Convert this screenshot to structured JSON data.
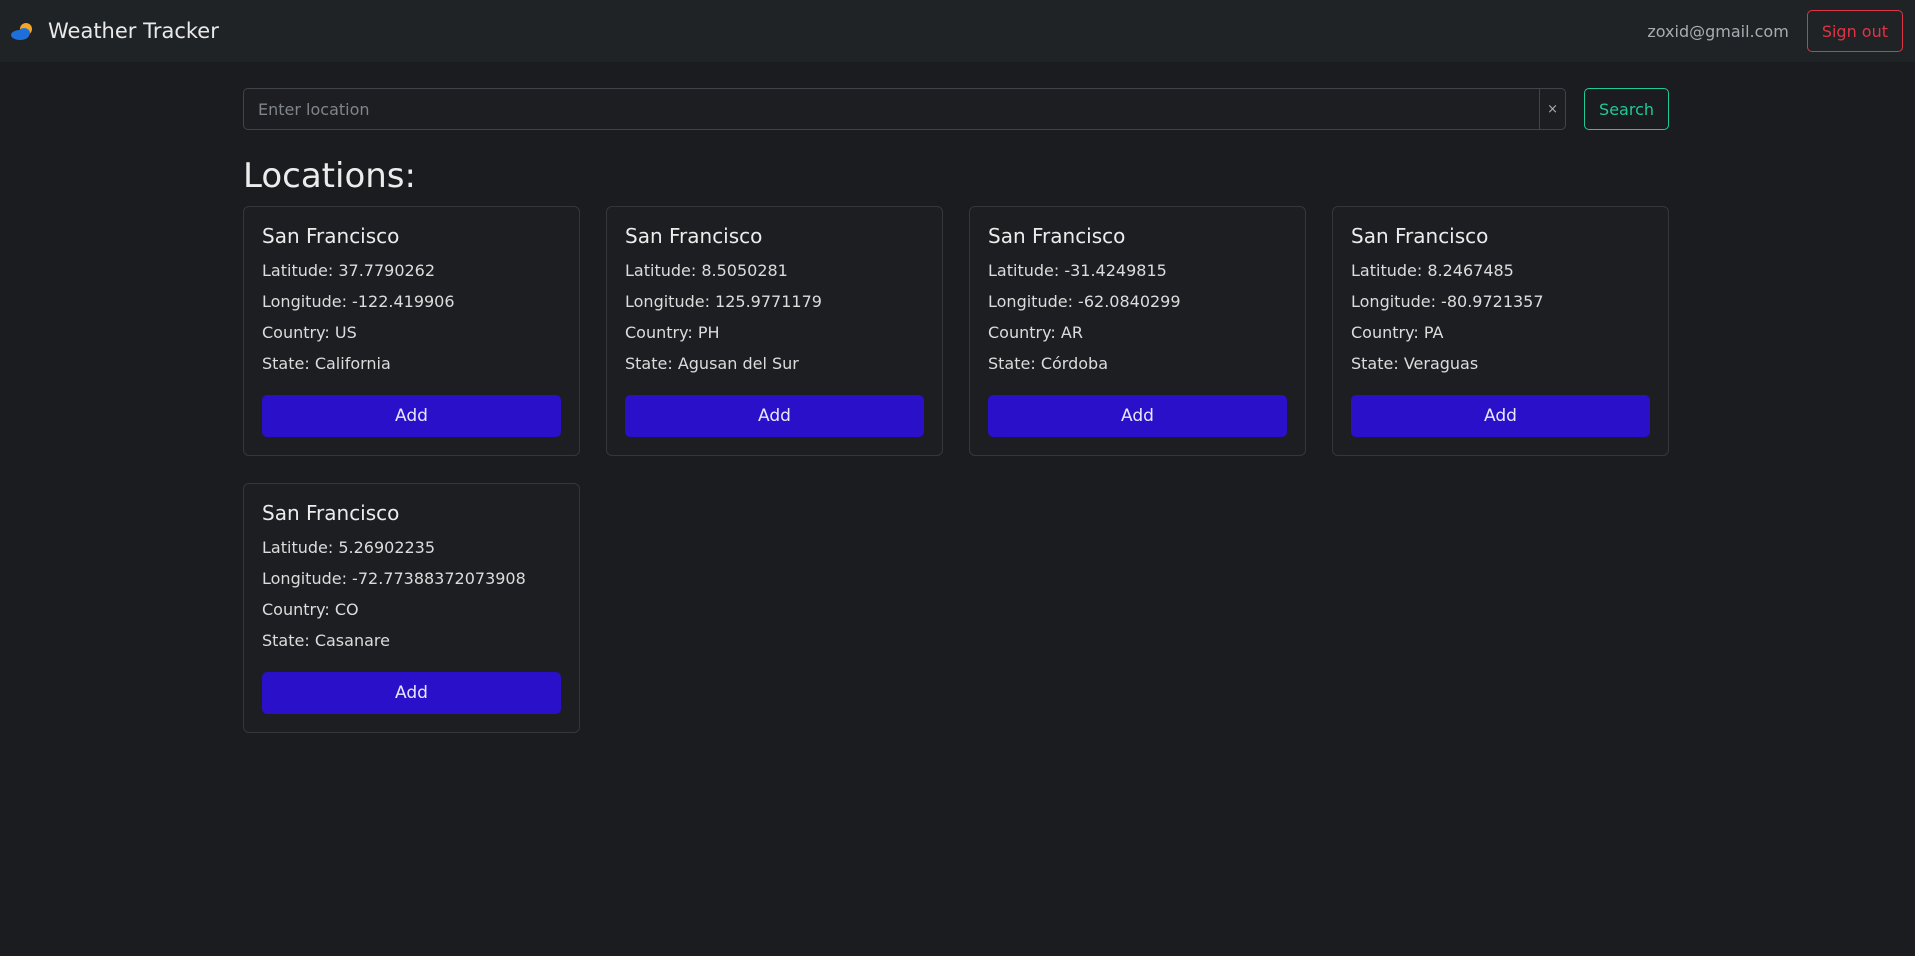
{
  "navbar": {
    "title": "Weather Tracker",
    "brand_icon": "cloud-sun-icon",
    "user_email": "zoxid@gmail.com",
    "signout_label": "Sign out"
  },
  "search": {
    "placeholder": "Enter location",
    "value": "",
    "clear_label": "×",
    "button_label": "Search"
  },
  "section_title": "Locations:",
  "locations": [
    {
      "name": "San Francisco",
      "lat": "Latitude: 37.7790262",
      "lon": "Longitude: -122.419906",
      "country": "Country: US",
      "state": "State: California",
      "button": "Add"
    },
    {
      "name": "San Francisco",
      "lat": "Latitude: 8.5050281",
      "lon": "Longitude: 125.9771179",
      "country": "Country: PH",
      "state": "State: Agusan del Sur",
      "button": "Add"
    },
    {
      "name": "San Francisco",
      "lat": "Latitude: -31.4249815",
      "lon": "Longitude: -62.0840299",
      "country": "Country: AR",
      "state": "State: Córdoba",
      "button": "Add"
    },
    {
      "name": "San Francisco",
      "lat": "Latitude: 8.2467485",
      "lon": "Longitude: -80.9721357",
      "country": "Country: PA",
      "state": "State: Veraguas",
      "button": "Add"
    },
    {
      "name": "San Francisco",
      "lat": "Latitude: 5.26902235",
      "lon": "Longitude: -72.77388372073908",
      "country": "Country: CO",
      "state": "State: Casanare",
      "button": "Add"
    }
  ],
  "colors": {
    "background": "#1a1c1f",
    "navbar": "#202326",
    "accent_add": "#2a10c9",
    "search_accent": "#20c997",
    "danger": "#dc3545"
  }
}
